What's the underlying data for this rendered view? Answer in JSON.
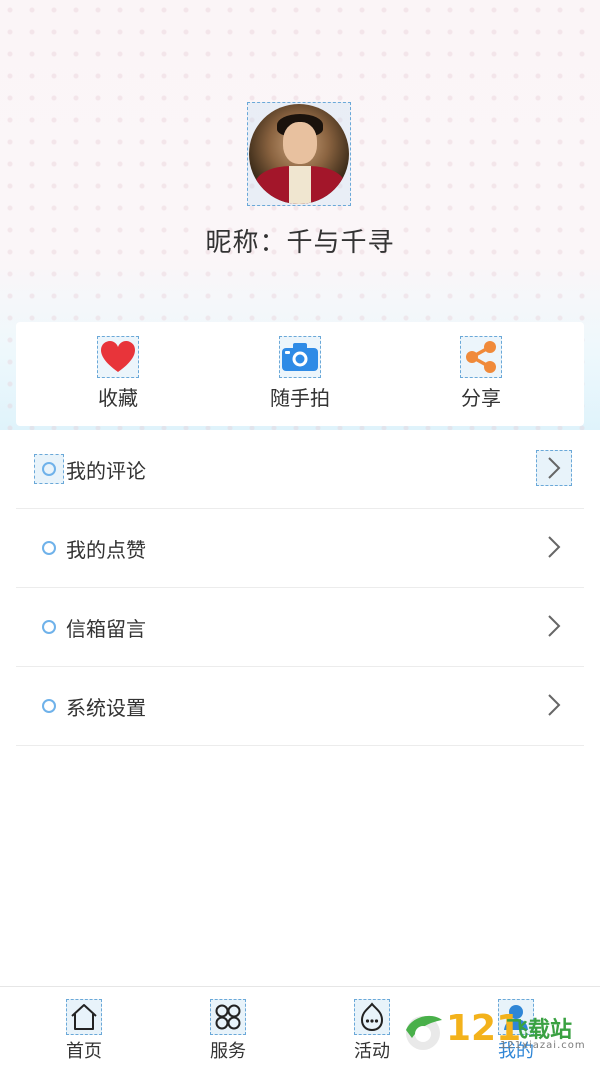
{
  "profile": {
    "nickname": "昵称：千与千寻"
  },
  "actions": [
    {
      "label": "收藏",
      "icon": "heart-icon",
      "color": "#e8343a"
    },
    {
      "label": "随手拍",
      "icon": "camera-icon",
      "color": "#2f8be6"
    },
    {
      "label": "分享",
      "icon": "share-icon",
      "color": "#f08a3a"
    }
  ],
  "menu": [
    {
      "label": "我的评论"
    },
    {
      "label": "我的点赞"
    },
    {
      "label": "信箱留言"
    },
    {
      "label": "系统设置"
    }
  ],
  "tabs": [
    {
      "label": "首页",
      "icon": "home-icon"
    },
    {
      "label": "服务",
      "icon": "grid-icon"
    },
    {
      "label": "活动",
      "icon": "chat-flame-icon"
    },
    {
      "label": "我的",
      "icon": "user-icon",
      "active": true
    }
  ],
  "watermark": {
    "number": "121",
    "text": "飞载站",
    "url": "121xiazai.com"
  },
  "colors": {
    "accent": "#2f86d6",
    "menu_dot": "#6fb2ea"
  }
}
